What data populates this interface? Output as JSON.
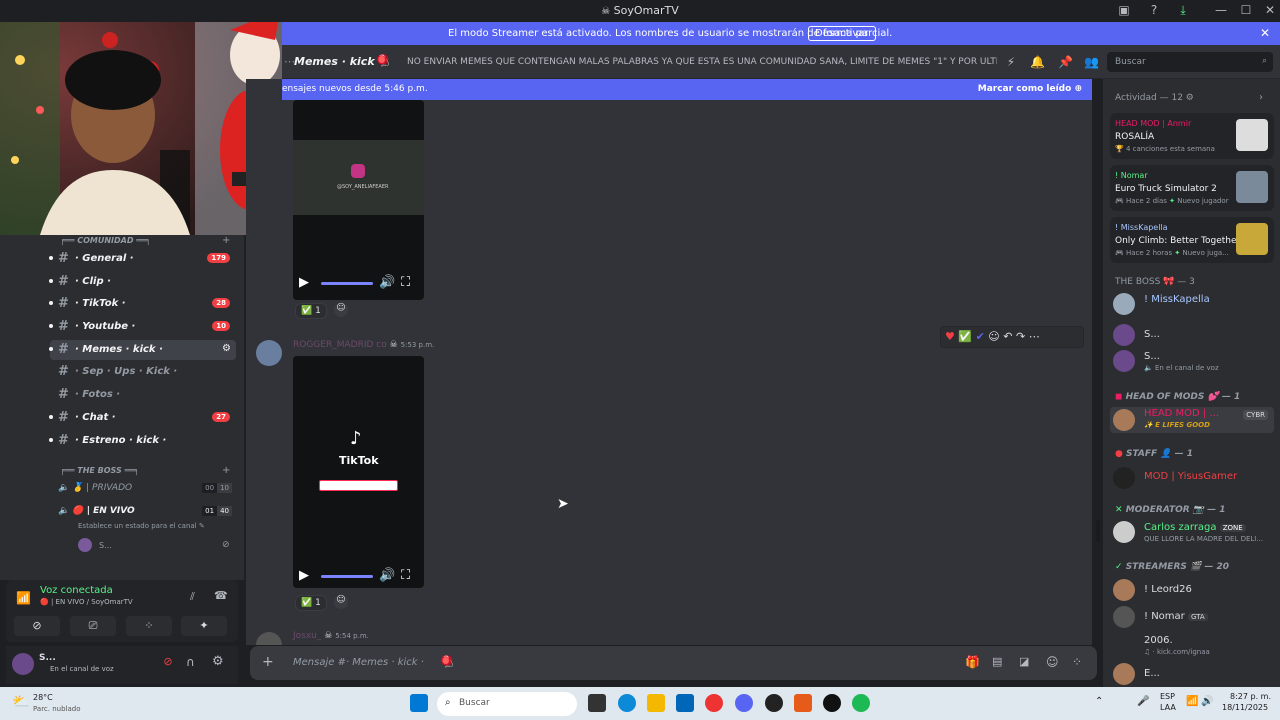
{
  "window": {
    "title": "SoyOmarTV"
  },
  "banner": {
    "text": "El modo Streamer está activado. Los nombres de usuario se mostrarán de forma parcial.",
    "button": "Desactivar"
  },
  "header": {
    "channel_name": "Memes · kick ·",
    "topic": "NO ENVIAR MEMES QUE CONTENGAN MALAS PALABRAS YA QUE ESTA ES UNA COMUNIDAD SANA, LIMITE DE MEMES \"1\" Y POR ULTIMO EL ...",
    "search_placeholder": "Buscar"
  },
  "new_messages": {
    "text": "ensajes nuevos desde 5:46 p.m.",
    "action": "Marcar como leído"
  },
  "sidebar": {
    "category1": "COMUNIDAD",
    "channels": [
      {
        "label": "· General ·",
        "badge": "179"
      },
      {
        "label": "· Clip ·",
        "badge": ""
      },
      {
        "label": "· TikTok ·",
        "badge": "28"
      },
      {
        "label": "· Youtube ·",
        "badge": "10"
      },
      {
        "label": "· Memes · kick ·",
        "badge": ""
      },
      {
        "label": "· Sep · Ups · Kick ·",
        "badge": ""
      },
      {
        "label": "· Fotos ·",
        "badge": ""
      },
      {
        "label": "· Chat ·",
        "badge": "27"
      },
      {
        "label": "· Estreno · kick ·",
        "badge": ""
      }
    ],
    "category2": "THE BOSS",
    "voice_channels": [
      {
        "label": "| PRIVADO",
        "count_a": "00",
        "count_b": "10"
      },
      {
        "label": "| EN VIVO",
        "count_a": "01",
        "count_b": "40"
      }
    ],
    "voice_status_hint": "Establece un estado para el canal",
    "voice_user": "S..."
  },
  "voice": {
    "status": "Voz conectada",
    "channel": "| EN VIVO / SoyOmarTV"
  },
  "user": {
    "name": "S...",
    "status": "En el canal de voz"
  },
  "messages": [
    {
      "reaction_count": "1"
    },
    {
      "author": "ROGGER_MADRID",
      "author_suffix": "co",
      "time": "5:53 p.m.",
      "video_brand": "TikTok",
      "reaction_count": "1"
    },
    {
      "author": "Josxu_",
      "time": "5:54 p.m."
    }
  ],
  "video1": {
    "watermark": "@SOY_ANELIAFEAER"
  },
  "composer": {
    "placeholder": "Mensaje #· Memes · kick ·"
  },
  "members": {
    "activity_header": "Actividad — 12",
    "activities": [
      {
        "name": "HEAD MOD | Anmir",
        "title": "ROSALÍA",
        "sub": "4 canciones esta semana"
      },
      {
        "name": "! Nomar",
        "title": "Euro Truck Simulator 2",
        "sub": "Hace 2 días",
        "sub2": "Nuevo jugador"
      },
      {
        "name": "! MissKapella",
        "title": "Only Climb: Better Together",
        "sub": "Hace 2 horas",
        "sub2": "Nuevo juga..."
      }
    ],
    "groups": [
      {
        "title": "THE BOSS",
        "count": "— 3"
      },
      {
        "title": "HEAD OF MODS",
        "count": "— 1"
      },
      {
        "title": "STAFF",
        "count": "— 1"
      },
      {
        "title": "MODERATOR",
        "count": "— 1"
      },
      {
        "title": "STREAMERS",
        "count": "— 20"
      }
    ],
    "boss": [
      {
        "name": "! MissKapella",
        "sub": ""
      },
      {
        "name": "S...",
        "sub": ""
      },
      {
        "name": "S...",
        "sub": "En el canal de voz"
      }
    ],
    "headmod": {
      "name": "HEAD MOD | ...",
      "sub": "E LIFES GOOD",
      "tag": "CYBR"
    },
    "staff": {
      "name": "MOD | YisusGamer"
    },
    "moderator": {
      "name": "Carlos zarraga",
      "tag": "ZONE",
      "sub": "QUE LLORE LA MADRE DEL DELI..."
    },
    "streamers": [
      {
        "name": "! Leord26",
        "sub": ""
      },
      {
        "name": "! Nomar",
        "tag": "GTA",
        "sub": ""
      },
      {
        "name": "2006.",
        "sub": "kick.com/ignaa"
      },
      {
        "name": "E...",
        "sub": ""
      }
    ]
  },
  "taskbar": {
    "weather_temp": "28°C",
    "weather_desc": "Parc. nublado",
    "search": "Buscar",
    "lang1": "ESP",
    "lang2": "LAA",
    "time": "8:27 p. m.",
    "date": "18/11/2025"
  },
  "colors": {
    "accent": "#5865f2",
    "badge": "#f23f43",
    "head_mod": "#e91e63",
    "staff": "#f23f43",
    "moderator": "#57f287",
    "boss": "#a8c7ff"
  }
}
